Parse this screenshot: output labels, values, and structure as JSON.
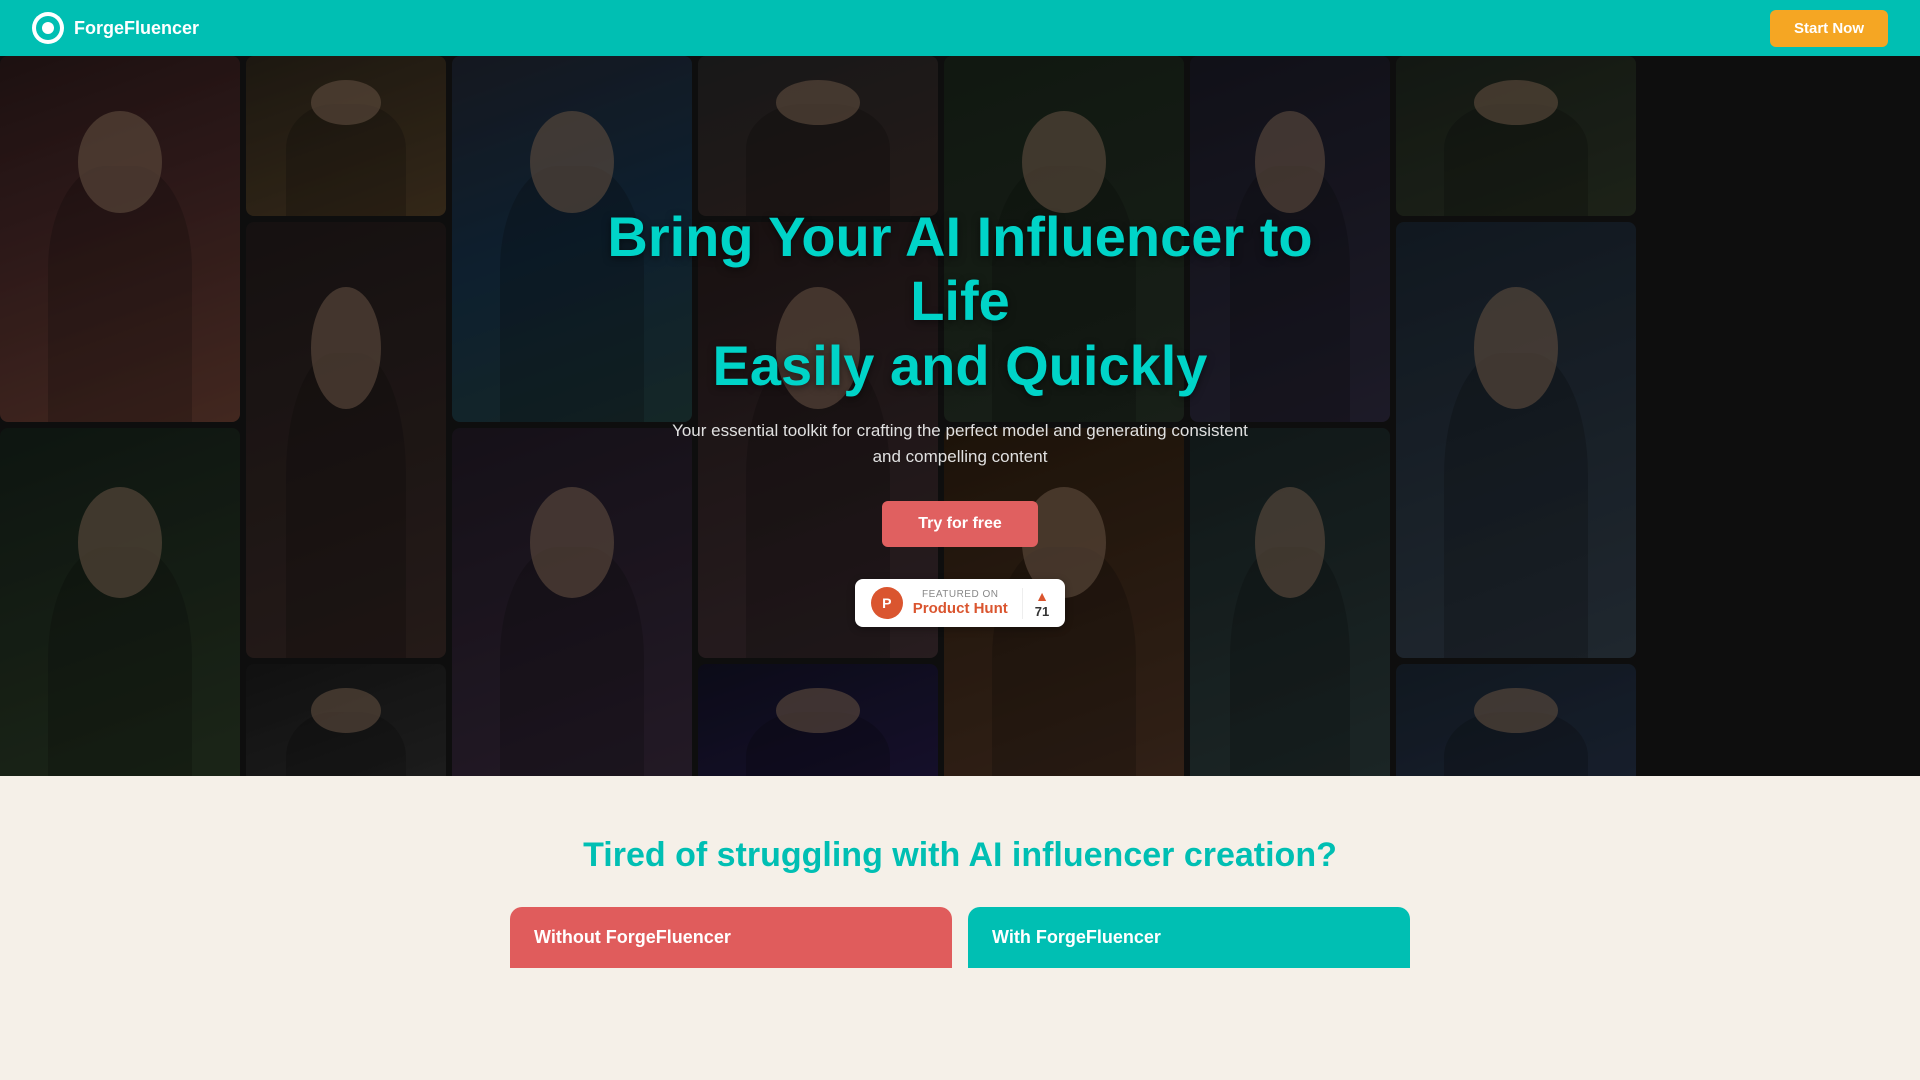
{
  "navbar": {
    "brand_name": "ForgeFluencer",
    "start_now_label": "Start Now"
  },
  "hero": {
    "title_line1": "Bring Your AI Influencer to Life",
    "title_line2": "Easily and Quickly",
    "subtitle": "Your essential toolkit for crafting the perfect model and generating consistent and compelling content",
    "cta_label": "Try for free",
    "image_cells": [
      1,
      2,
      3,
      4,
      5,
      6,
      7,
      8,
      9,
      10,
      11,
      12,
      13,
      14,
      15,
      16,
      17
    ]
  },
  "product_hunt": {
    "featured_label": "FEATURED ON",
    "name": "Product Hunt",
    "vote_count": "71"
  },
  "second_section": {
    "title": "Tired of struggling with AI influencer creation?",
    "card_without_label": "Without ForgeFluencer",
    "card_with_label": "With ForgeFluencer"
  }
}
